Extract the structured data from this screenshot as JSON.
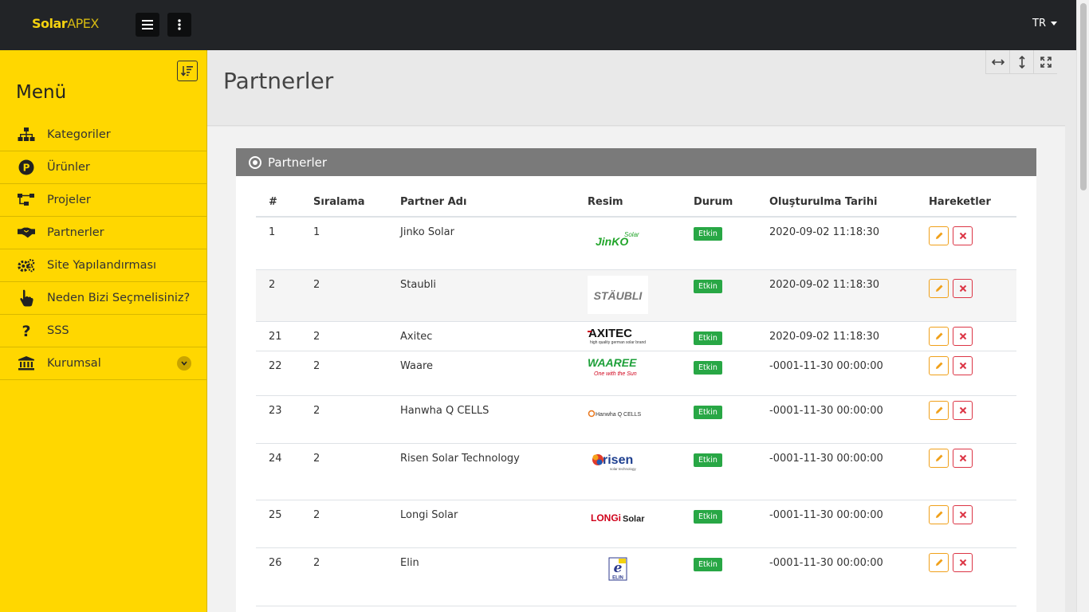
{
  "brand": {
    "part1": "Solar",
    "part2": "APEX"
  },
  "topbar": {
    "language": "TR"
  },
  "sidebar": {
    "title": "Menü",
    "items": [
      {
        "label": "Kategoriler",
        "icon": "sitemap-icon"
      },
      {
        "label": "Ürünler",
        "icon": "product-p-icon"
      },
      {
        "label": "Projeler",
        "icon": "project-tree-icon"
      },
      {
        "label": "Partnerler",
        "icon": "handshake-icon"
      },
      {
        "label": "Site Yapılandırması",
        "icon": "cogs-icon"
      },
      {
        "label": "Neden Bizi Seçmelisiniz?",
        "icon": "hand-pointer-icon"
      },
      {
        "label": "SSS",
        "icon": "question-icon"
      },
      {
        "label": "Kurumsal",
        "icon": "institution-icon",
        "expandable": true
      }
    ]
  },
  "page": {
    "title": "Partnerler"
  },
  "panel": {
    "title": "Partnerler"
  },
  "table": {
    "headers": [
      "#",
      "Sıralama",
      "Partner Adı",
      "Resim",
      "Durum",
      "Oluşturulma Tarihi",
      "Hareketler"
    ],
    "rows": [
      {
        "id": "1",
        "order": "1",
        "name": "Jinko Solar",
        "logo_main": "JinKO",
        "logo_sub": "Solar",
        "status": "Etkin",
        "date": "2020-09-02 11:18:30"
      },
      {
        "id": "2",
        "order": "2",
        "name": "Staubli",
        "logo_main": "STÄUBLI",
        "logo_sub": "",
        "status": "Etkin",
        "date": "2020-09-02 11:18:30"
      },
      {
        "id": "21",
        "order": "2",
        "name": "Axitec",
        "logo_main": "AXITEC",
        "logo_sub": "high quality german solar brand",
        "status": "Etkin",
        "date": "2020-09-02 11:18:30"
      },
      {
        "id": "22",
        "order": "2",
        "name": "Waare",
        "logo_main": "WAAREE",
        "logo_sub": "One with the Sun",
        "status": "Etkin",
        "date": "-0001-11-30 00:00:00"
      },
      {
        "id": "23",
        "order": "2",
        "name": "Hanwha Q CELLS",
        "logo_main": "Hanwha Q CELLS",
        "logo_sub": "",
        "status": "Etkin",
        "date": "-0001-11-30 00:00:00"
      },
      {
        "id": "24",
        "order": "2",
        "name": "Risen Solar Technology",
        "logo_main": "risen",
        "logo_sub": "solar technology",
        "status": "Etkin",
        "date": "-0001-11-30 00:00:00"
      },
      {
        "id": "25",
        "order": "2",
        "name": "Longi Solar",
        "logo_main": "LONGi",
        "logo_sub": "Solar",
        "status": "Etkin",
        "date": "-0001-11-30 00:00:00"
      },
      {
        "id": "26",
        "order": "2",
        "name": "Elin",
        "logo_main": "e",
        "logo_sub": "ELIN",
        "status": "Etkin",
        "date": "-0001-11-30 00:00:00"
      }
    ]
  },
  "colors": {
    "sidebar": "#ffd700",
    "topbar": "#222427",
    "panel_header": "#7a7a7a",
    "badge": "#28a745",
    "edit": "#f0a01a",
    "delete": "#dc3545"
  }
}
